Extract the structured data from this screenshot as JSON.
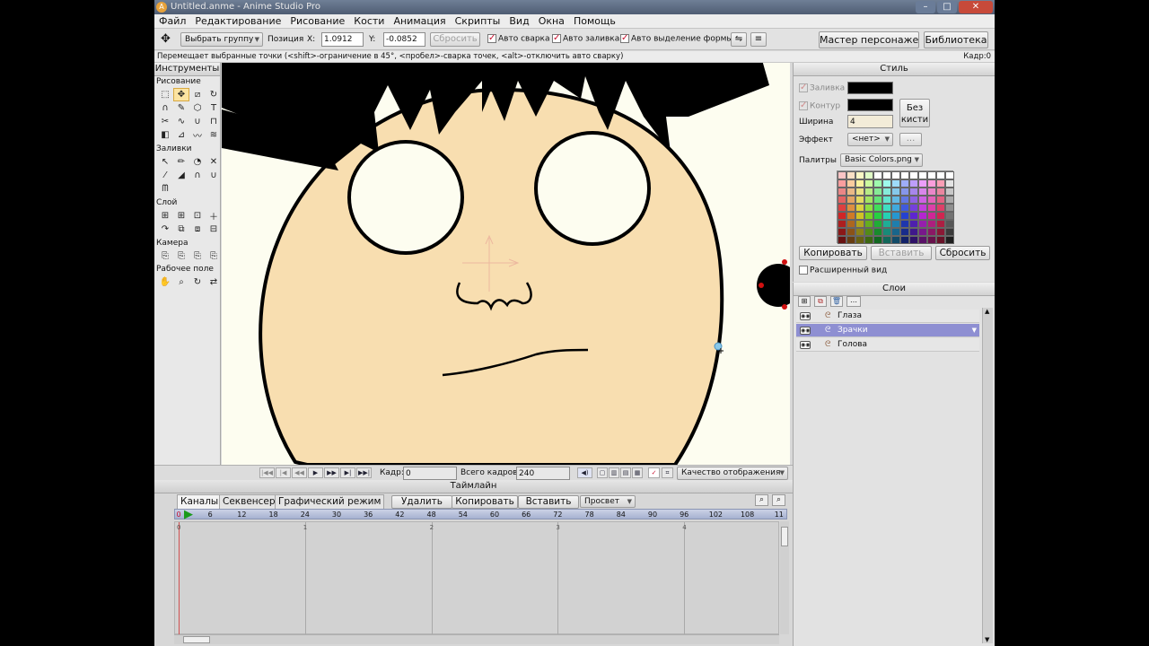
{
  "title": "Untitled.anme - Anime Studio Pro",
  "menu": [
    "Файл",
    "Редактирование",
    "Рисование",
    "Кости",
    "Анимация",
    "Скрипты",
    "Вид",
    "Окна",
    "Помощь"
  ],
  "toolbar": {
    "select_group": "Выбрать группу",
    "position_label": "Позиция",
    "x_label": "X:",
    "x_value": "1.0912",
    "y_label": "Y:",
    "y_value": "-0.0852",
    "reset": "Сбросить",
    "auto_weld": "Авто сварка",
    "auto_fill": "Авто заливка",
    "auto_select": "Авто выделение формы",
    "character_wizard": "Мастер персонажей",
    "library": "Библиотека"
  },
  "hint": "Перемещает выбранные точки (<shift>-ограничение в 45°, <пробел>-сварка точек, <alt>-отключить авто сварку)",
  "frame_indicator": "Кадр:0",
  "tools_panel": {
    "title": "Инструменты",
    "sections": [
      "Рисование",
      "Заливки",
      "Слой",
      "Камера",
      "Рабочее поле"
    ]
  },
  "style_panel": {
    "title": "Стиль",
    "fill_label": "Заливка",
    "stroke_label": "Контур",
    "no_brush": "Без кисти",
    "width_label": "Ширина",
    "width_value": "4",
    "effect_label": "Эффект",
    "effect_value": "<нет>",
    "more": "...",
    "palettes_label": "Палитры",
    "palette_value": "Basic Colors.png",
    "copy": "Копировать",
    "paste": "Вставить",
    "reset": "Сбросить",
    "advanced": "Расширенный вид",
    "fill_color": "#000000",
    "stroke_color": "#000000"
  },
  "layers_panel": {
    "title": "Слои",
    "layers": [
      {
        "name": "Глаза",
        "selected": false
      },
      {
        "name": "Зрачки",
        "selected": true
      },
      {
        "name": "Голова",
        "selected": false
      }
    ]
  },
  "frame_bar": {
    "frame_label": "Кадр:",
    "frame_value": "0",
    "total_label": "Всего кадров:",
    "total_value": "240",
    "quality": "Качество отображения"
  },
  "timeline": {
    "title": "Таймлайн",
    "tabs": [
      "Каналы",
      "Секвенсер",
      "Графический режим"
    ],
    "delete": "Удалить",
    "copy": "Копировать",
    "paste": "Вставить",
    "preview": "Просвет",
    "ruler": [
      "0",
      "6",
      "12",
      "18",
      "24",
      "30",
      "36",
      "42",
      "48",
      "54",
      "60",
      "66",
      "72",
      "78",
      "84",
      "90",
      "96",
      "102",
      "108",
      "11"
    ],
    "seconds": [
      "0",
      "1",
      "2",
      "3",
      "4"
    ]
  },
  "colors": {
    "skin": "#f8deb0",
    "canvas_bg": "#fdfdf0",
    "layer_selected": "#8e8fd2",
    "selection_tool": "#fce4a2"
  }
}
